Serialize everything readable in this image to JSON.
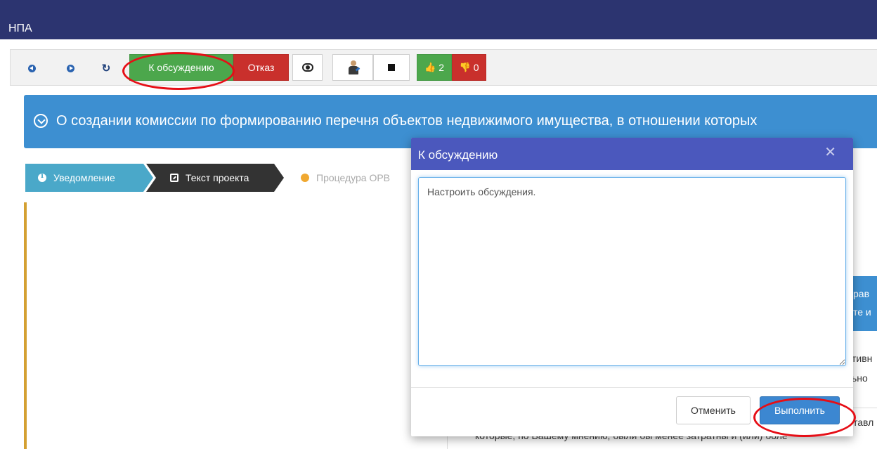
{
  "app": {
    "title": "НПА"
  },
  "toolbar": {
    "back_icon": "arrow-left-circle-icon",
    "forward_icon": "arrow-right-circle-icon",
    "refresh_icon": "refresh-icon",
    "discuss_label": "К обсуждению",
    "reject_label": "Отказ",
    "view_icon": "eye-icon",
    "user_icon": "user-pen-icon",
    "stop_icon": "stop-square-icon",
    "likes": "2",
    "dislikes": "0",
    "like_symbol": "👍",
    "dislike_symbol": "👎"
  },
  "banner": {
    "title": "О создании комиссии по формированию перечня объектов недвижимого имущества, в отношении которых"
  },
  "steps": [
    {
      "label": "Уведомление"
    },
    {
      "label": "Текст проекта"
    },
    {
      "label": "Процедура ОРВ"
    }
  ],
  "background_peek": {
    "blue_line1": "рав",
    "blue_line2": "те и",
    "text1": "тивн",
    "text2": "ьно",
    "text3": "тавл",
    "bottom_text": "которые, по Вашему мнению, были бы менее затратны и (или) боле"
  },
  "modal": {
    "title": "К обсуждению",
    "close_symbol": "✕",
    "textarea_value": "Настроить обсуждения.",
    "cancel_label": "Отменить",
    "submit_label": "Выполнить"
  },
  "colors": {
    "topbar": "#2c3470",
    "accent_blue": "#3d8fd1",
    "green": "#4ca74c",
    "red": "#c9302c",
    "modal_header": "#4b58bd",
    "annotation_red": "#e60e16"
  }
}
